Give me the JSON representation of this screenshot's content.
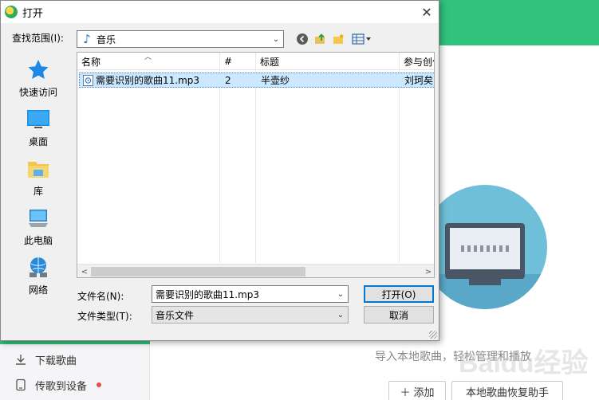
{
  "dialog": {
    "title": "打开",
    "close_label": "✕",
    "look_in_label": "查找范围(I):",
    "look_in_value": "音乐",
    "places": [
      {
        "label": "快速访问",
        "icon": "star-icon"
      },
      {
        "label": "桌面",
        "icon": "desktop-icon"
      },
      {
        "label": "库",
        "icon": "library-folder-icon"
      },
      {
        "label": "此电脑",
        "icon": "computer-icon"
      },
      {
        "label": "网络",
        "icon": "network-icon"
      }
    ],
    "columns": [
      "名称",
      "#",
      "标题",
      "参与创作"
    ],
    "files": [
      {
        "name": "需要识别的歌曲11.mp3",
        "track": "2",
        "title": "半壶纱",
        "artist": "刘珂矣"
      }
    ],
    "filename_label": "文件名(N):",
    "filename_value": "需要识别的歌曲11.mp3",
    "filetype_label": "文件类型(T):",
    "filetype_value": "音乐文件",
    "open_button": "打开(O)",
    "cancel_button": "取消"
  },
  "app": {
    "sidebar_items": [
      {
        "label": "下载歌曲",
        "icon": "download-icon"
      },
      {
        "label": "传歌到设备",
        "icon": "device-icon"
      }
    ],
    "import_text": "导入本地歌曲，轻松管理和播放",
    "add_button": "添加",
    "recover_button": "本地歌曲恢复助手",
    "watermark": "Baidu经验"
  },
  "colors": {
    "accent_green": "#31c27c",
    "selection": "#cce8ff",
    "focus_blue": "#0078d7"
  }
}
